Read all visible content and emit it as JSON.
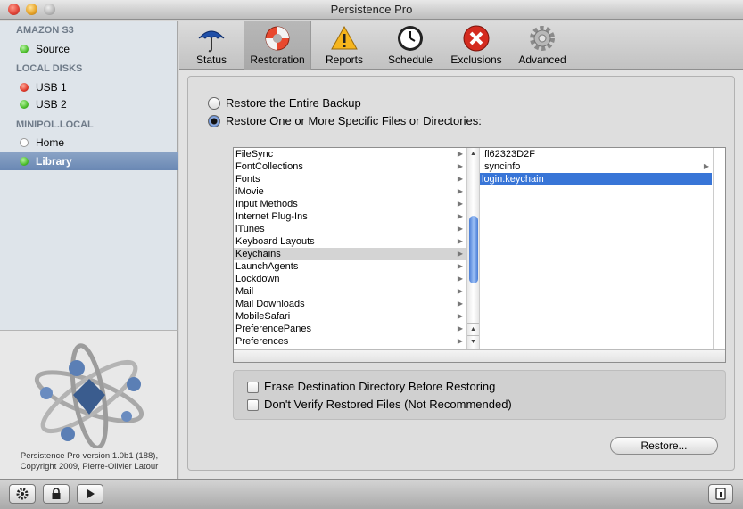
{
  "window": {
    "title": "Persistence Pro"
  },
  "sidebar": {
    "sections": [
      {
        "title": "AMAZON S3",
        "items": [
          {
            "label": "Source",
            "status": "green"
          }
        ]
      },
      {
        "title": "LOCAL DISKS",
        "items": [
          {
            "label": "USB 1",
            "status": "red"
          },
          {
            "label": "USB 2",
            "status": "green"
          }
        ]
      },
      {
        "title": "MINIPOL.LOCAL",
        "items": [
          {
            "label": "Home",
            "status": "none"
          },
          {
            "label": "Library",
            "status": "green",
            "selected": true
          }
        ]
      }
    ],
    "version_line1": "Persistence Pro version 1.0b1 (188),",
    "version_line2": "Copyright 2009, Pierre-Olivier Latour"
  },
  "toolbar": {
    "items": [
      {
        "label": "Status",
        "icon": "umbrella-icon"
      },
      {
        "label": "Restoration",
        "icon": "lifebuoy-icon",
        "active": true
      },
      {
        "label": "Reports",
        "icon": "warning-icon"
      },
      {
        "label": "Schedule",
        "icon": "clock-icon"
      },
      {
        "label": "Exclusions",
        "icon": "x-circle-icon"
      },
      {
        "label": "Advanced",
        "icon": "gear-icon"
      }
    ]
  },
  "restore": {
    "option_entire": "Restore the Entire Backup",
    "option_specific": "Restore One or More Specific Files or Directories:",
    "selected_option": "specific",
    "column1": [
      "FileSync",
      "FontCollections",
      "Fonts",
      "iMovie",
      "Input Methods",
      "Internet Plug-Ins",
      "iTunes",
      "Keyboard Layouts",
      "Keychains",
      "LaunchAgents",
      "Lockdown",
      "Mail",
      "Mail Downloads",
      "MobileSafari",
      "PreferencePanes",
      "Preferences"
    ],
    "column1_selected": "Keychains",
    "column2": [
      {
        "label": ".fl62323D2F",
        "folder": false
      },
      {
        "label": ".syncinfo",
        "folder": true
      },
      {
        "label": "login.keychain",
        "folder": false,
        "selected": true
      }
    ],
    "erase_label": "Erase Destination Directory Before Restoring",
    "erase_checked": false,
    "verify_label": "Don't Verify Restored Files (Not Recommended)",
    "verify_checked": false,
    "restore_button": "Restore..."
  },
  "bottom_bar": {
    "buttons": [
      "gear-icon",
      "lock-icon",
      "play-icon"
    ],
    "right_button": "info-icon"
  },
  "colors": {
    "selection_blue": "#3875d7",
    "sidebar_bg": "#dee4ea"
  }
}
